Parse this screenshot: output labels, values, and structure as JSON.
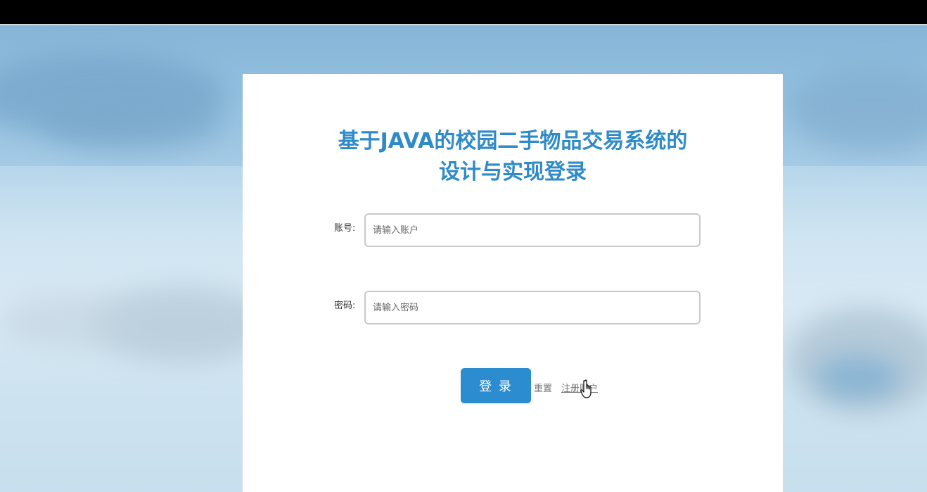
{
  "page": {
    "title_line1": "基于JAVA的校园二手物品交易系统的",
    "title_line2": "设计与实现登录"
  },
  "form": {
    "username_label": "账号:",
    "username_placeholder": "请输入账户",
    "password_label": "密码:",
    "password_placeholder": "请输入密码"
  },
  "actions": {
    "login_label": "登 录",
    "reset_label": "重置",
    "register_label": "注册账户"
  },
  "colors": {
    "accent": "#2b8ccf",
    "title": "#2f8ac8"
  },
  "icons": {
    "cursor": "hand-pointer-icon"
  }
}
